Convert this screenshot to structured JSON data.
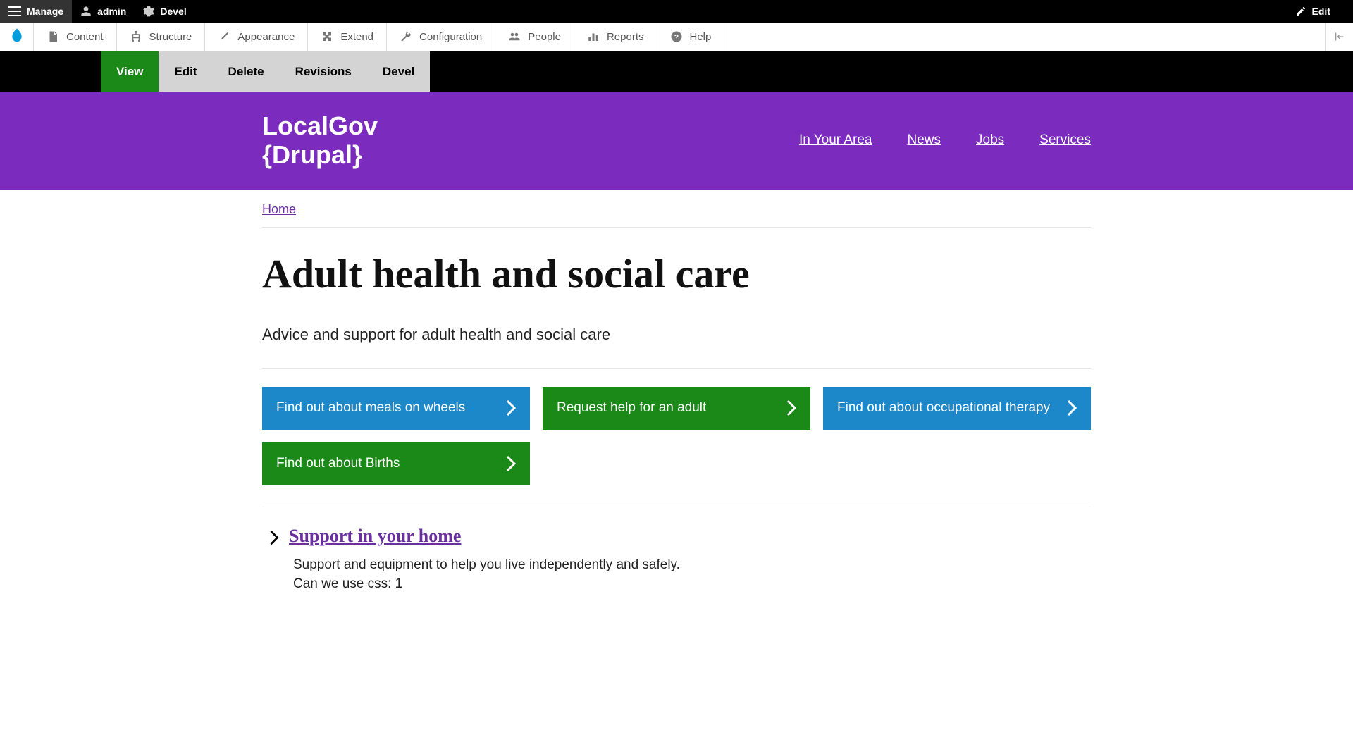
{
  "top_toolbar": {
    "manage": "Manage",
    "admin": "admin",
    "devel": "Devel",
    "edit": "Edit"
  },
  "admin_menu": {
    "items": [
      {
        "label": "Content",
        "icon": "file"
      },
      {
        "label": "Structure",
        "icon": "structure"
      },
      {
        "label": "Appearance",
        "icon": "paint"
      },
      {
        "label": "Extend",
        "icon": "puzzle"
      },
      {
        "label": "Configuration",
        "icon": "wrench"
      },
      {
        "label": "People",
        "icon": "people"
      },
      {
        "label": "Reports",
        "icon": "bars"
      },
      {
        "label": "Help",
        "icon": "help"
      }
    ]
  },
  "node_tabs": [
    {
      "label": "View",
      "active": true
    },
    {
      "label": "Edit",
      "active": false
    },
    {
      "label": "Delete",
      "active": false
    },
    {
      "label": "Revisions",
      "active": false
    },
    {
      "label": "Devel",
      "active": false
    }
  ],
  "site": {
    "name_line1": "LocalGov",
    "name_line2": "{Drupal}",
    "nav": [
      {
        "label": "In Your Area"
      },
      {
        "label": "News"
      },
      {
        "label": "Jobs"
      },
      {
        "label": "Services"
      }
    ]
  },
  "breadcrumb": {
    "home": "Home"
  },
  "page": {
    "title": "Adult health and social care",
    "intro": "Advice and support for adult health and social care"
  },
  "action_buttons": [
    {
      "label": "Find out about meals on wheels",
      "color": "blue"
    },
    {
      "label": "Request help for an adult",
      "color": "green"
    },
    {
      "label": "Find out about occupational therapy",
      "color": "blue"
    },
    {
      "label": "Find out about Births",
      "color": "green"
    }
  ],
  "list_items": [
    {
      "title": "Support in your home",
      "desc_line1": "Support and equipment to help you live independently and safely.",
      "desc_line2": "Can we use css: 1"
    }
  ]
}
